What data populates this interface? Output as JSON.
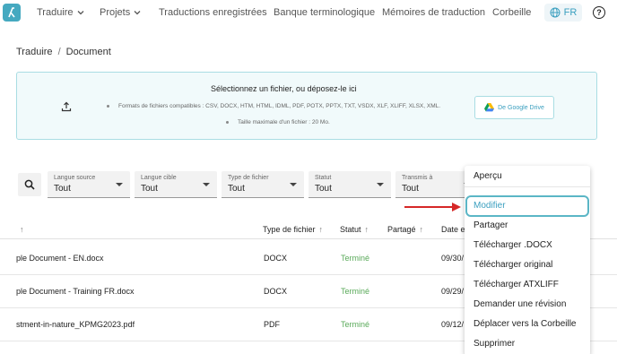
{
  "nav": {
    "items": [
      {
        "label": "Traduire",
        "dropdown": true
      },
      {
        "label": "Projets",
        "dropdown": true
      },
      {
        "label": "Traductions enregistrées",
        "dropdown": false
      },
      {
        "label": "Banque terminologique",
        "dropdown": false
      },
      {
        "label": "Mémoires de traduction",
        "dropdown": false
      },
      {
        "label": "Corbeille",
        "dropdown": false
      }
    ],
    "language": "FR",
    "help": "?"
  },
  "breadcrumb": {
    "root": "Traduire",
    "separator": "/",
    "current": "Document"
  },
  "upload": {
    "title": "Sélectionnez un fichier, ou déposez-le ici",
    "formats": "Formats de fichiers compatibles : CSV, DOCX, HTM, HTML, IDML, PDF, POTX, PPTX, TXT, VSDX, XLF, XLIFF, XLSX, XML.",
    "max_size": "Taille maximale d'un fichier : 20 Mo.",
    "google_drive": "De Google Drive"
  },
  "filters": [
    {
      "label": "Langue source",
      "value": "Tout"
    },
    {
      "label": "Langue cible",
      "value": "Tout"
    },
    {
      "label": "Type de fichier",
      "value": "Tout"
    },
    {
      "label": "Statut",
      "value": "Tout"
    },
    {
      "label": "Transmis à",
      "value": "Tout"
    }
  ],
  "table": {
    "headers": {
      "name_arrow": "↑",
      "file_type": "Type de fichier",
      "status": "Statut",
      "shared": "Partagé",
      "date": "Date et"
    },
    "rows": [
      {
        "name": "ple Document - EN.docx",
        "type": "DOCX",
        "status": "Terminé",
        "date": "09/30/"
      },
      {
        "name": "ple Document - Training FR.docx",
        "type": "DOCX",
        "status": "Terminé",
        "date": "09/29/"
      },
      {
        "name": "stment-in-nature_KPMG2023.pdf",
        "type": "PDF",
        "status": "Terminé",
        "date": "09/12/"
      }
    ]
  },
  "context_menu": {
    "items": [
      "Aperçu",
      "Modifier",
      "Partager",
      "Télécharger .DOCX",
      "Télécharger original",
      "Télécharger ATXLIFF",
      "Demander une révision",
      "Déplacer vers la Corbeille",
      "Supprimer"
    ],
    "highlighted": "Modifier"
  },
  "colors": {
    "accent": "#3a9fbf",
    "logo": "#45a9c0",
    "status_done": "#5aaa5a",
    "arrow": "#d62828",
    "highlight": "#5bb6c6"
  }
}
